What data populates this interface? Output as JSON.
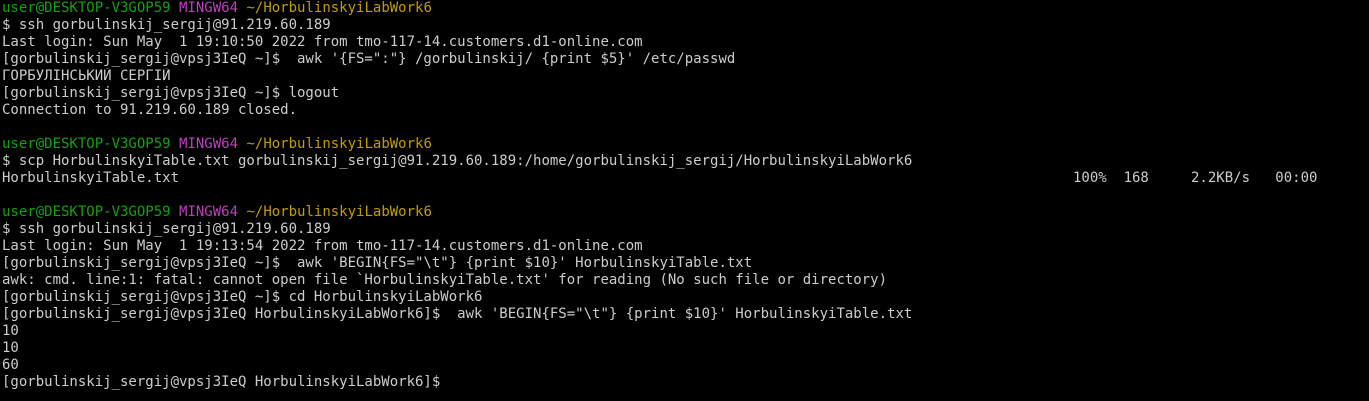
{
  "session1": {
    "prompt_user_host": "user@DESKTOP-V3GOP59",
    "prompt_env": "MINGW64",
    "prompt_path": "~/HorbulinskyiLabWork6",
    "lines": [
      "$ ssh gorbulinskij_sergij@91.219.60.189",
      "Last login: Sun May  1 19:10:50 2022 from tmo-117-14.customers.d1-online.com",
      "[gorbulinskij_sergij@vpsj3IeQ ~]$  awk '{FS=\":\"} /gorbulinskij/ {print $5}' /etc/passwd",
      "ГОРБУЛІНСЬКИЙ СЕРГІЙ",
      "[gorbulinskij_sergij@vpsj3IeQ ~]$ logout",
      "Connection to 91.219.60.189 closed."
    ]
  },
  "session2": {
    "prompt_user_host": "user@DESKTOP-V3GOP59",
    "prompt_env": "MINGW64",
    "prompt_path": "~/HorbulinskyiLabWork6",
    "command": "$ scp HorbulinskyiTable.txt gorbulinskij_sergij@91.219.60.189:/home/gorbulinskij_sergij/HorbulinskyiLabWork6",
    "transfer_file": "HorbulinskyiTable.txt",
    "transfer_stats": "100%  168     2.2KB/s   00:00"
  },
  "session3": {
    "prompt_user_host": "user@DESKTOP-V3GOP59",
    "prompt_env": "MINGW64",
    "prompt_path": "~/HorbulinskyiLabWork6",
    "lines": [
      "$ ssh gorbulinskij_sergij@91.219.60.189",
      "Last login: Sun May  1 19:13:54 2022 from tmo-117-14.customers.d1-online.com",
      "[gorbulinskij_sergij@vpsj3IeQ ~]$  awk 'BEGIN{FS=\"\\t\"} {print $10}' HorbulinskyiTable.txt",
      "awk: cmd. line:1: fatal: cannot open file `HorbulinskyiTable.txt' for reading (No such file or directory)",
      "[gorbulinskij_sergij@vpsj3IeQ ~]$ cd HorbulinskyiLabWork6",
      "[gorbulinskij_sergij@vpsj3IeQ HorbulinskyiLabWork6]$  awk 'BEGIN{FS=\"\\t\"} {print $10}' HorbulinskyiTable.txt",
      "10",
      "10",
      "60",
      "[gorbulinskij_sergij@vpsj3IeQ HorbulinskyiLabWork6]$"
    ]
  },
  "colors": {
    "background": "#000000",
    "text": "#cccccc",
    "user_host": "#13a10e",
    "env": "#bc3fbc",
    "path": "#c19c00"
  }
}
